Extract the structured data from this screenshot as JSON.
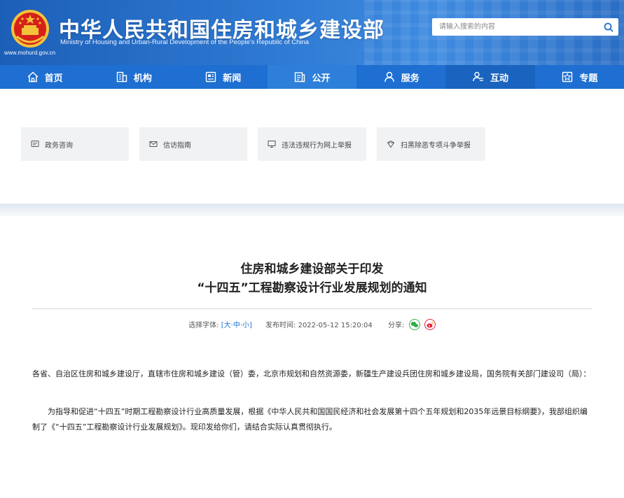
{
  "header": {
    "title": "中华人民共和国住房和城乡建设部",
    "subtitle": "Ministry of Housing and Urban-Rural Development of the People's Republic of China",
    "url": "www.mohurd.gov.cn",
    "emblem_icon": "national-emblem-icon",
    "search_placeholder": "请输入搜索的内容",
    "search_icon": "search-icon",
    "colors": {
      "header_blue": "#1c5fb8",
      "nav_blue": "#1e6fd1",
      "emblem_red": "#d6201a",
      "emblem_gold": "#f3c23a"
    }
  },
  "nav": {
    "items": [
      {
        "label": "首页",
        "icon": "home-icon"
      },
      {
        "label": "机构",
        "icon": "organization-icon"
      },
      {
        "label": "新闻",
        "icon": "news-icon"
      },
      {
        "label": "公开",
        "icon": "public-info-icon"
      },
      {
        "label": "服务",
        "icon": "service-icon"
      },
      {
        "label": "互动",
        "icon": "interaction-icon"
      },
      {
        "label": "专题",
        "icon": "topic-icon"
      }
    ]
  },
  "quick_links": [
    {
      "label": "政务咨询",
      "icon": "message-icon"
    },
    {
      "label": "信访指南",
      "icon": "mail-icon"
    },
    {
      "label": "违法违规行为网上举报",
      "icon": "monitor-icon"
    },
    {
      "label": "扫黑除恶专项斗争举报",
      "icon": "shield-icon"
    }
  ],
  "article": {
    "title_line1": "住房和城乡建设部关于印发",
    "title_line2": "“十四五”工程勘察设计行业发展规划的通知",
    "font_label": "选择字体:",
    "bracket_open": "[",
    "font_large": "大",
    "sep1": "·",
    "font_medium": "中",
    "sep2": "·",
    "font_small": "小",
    "bracket_close": "]",
    "publish_label": "发布时间:",
    "publish_time": "2022-05-12 15:20:04",
    "share_label": "分享:",
    "paragraphs": [
      "各省、自治区住房和城乡建设厅，直辖市住房和城乡建设（管）委，北京市规划和自然资源委，新疆生产建设兵团住房和城乡建设局，国务院有关部门建设司（局）：",
      "为指导和促进“十四五”时期工程勘察设计行业高质量发展，根据《中华人民共和国国民经济和社会发展第十四个五年规划和2035年远景目标纲要》，我部组织编制了《“十四五”工程勘察设计行业发展规划》。现印发给你们，请结合实际认真贯彻执行。"
    ]
  }
}
